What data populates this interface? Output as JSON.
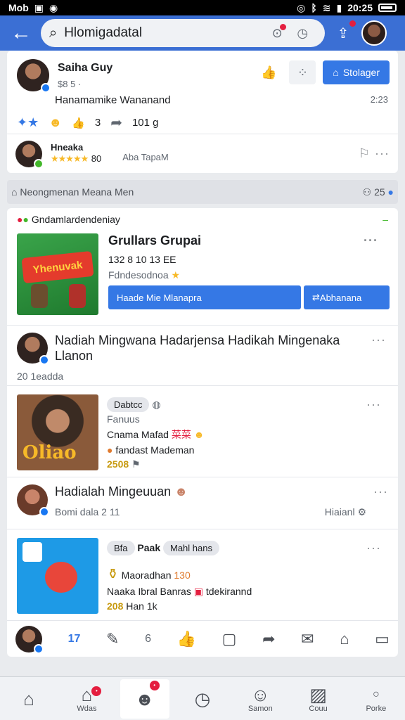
{
  "status": {
    "left": "Mob",
    "time": "20:25"
  },
  "search": {
    "value": "Hlomigadatal"
  },
  "post1": {
    "name": "Saiha Guy",
    "sub": "$8 5 ·",
    "button": "Stolager",
    "body": "Hanamamike Wananand",
    "body_right": "2:23",
    "reaction_count": "3",
    "share_count": "101 g",
    "footer_name": "Hneaka",
    "footer_count": "80",
    "footer_text": "Aba TapaM"
  },
  "strip": {
    "left": "Neongmenan",
    "mid": "Meana Men",
    "right": "25"
  },
  "group": {
    "header": "Gndamlardendeniay",
    "name": "Grullars Grupai",
    "meta": "132 8 10 13 EE",
    "desc": "Fdndesodnoa",
    "thumb_text": "Yhenuvak",
    "btn_left": "Haade Mie Mlanapra",
    "btn_right": "Abhanana"
  },
  "row2": {
    "title": "Nadiah Mingwana Hadarjensa Hadikah Mingenaka Llanon",
    "meta": "20 1eadda"
  },
  "row3": {
    "pill": "Dabtcc",
    "l1": "Fanuus",
    "l2": "Cnama Mafad",
    "l2b": "菜菜",
    "l3": "fandast Mademan",
    "count": "2508",
    "thumb_text": "Oliao"
  },
  "row4": {
    "title": "Hadialah Mingeuuan",
    "meta": "Bomi dala 2 11",
    "right": "Hiaianl"
  },
  "row5": {
    "pill1": "Bfa",
    "pill2": "Paak",
    "pill3": "Mahl hans",
    "l1": "Maoradhan",
    "l1b": "130",
    "l2": "Naaka Ibral Banras",
    "l2b": "tdekirannd",
    "count": "208",
    "l3": "Han 1k"
  },
  "actionbar": {
    "count": "17",
    "count2": "6"
  },
  "bottom": {
    "t2": "Wdas",
    "t5": "Samon",
    "t6": "Couu",
    "t7": "Porke"
  }
}
